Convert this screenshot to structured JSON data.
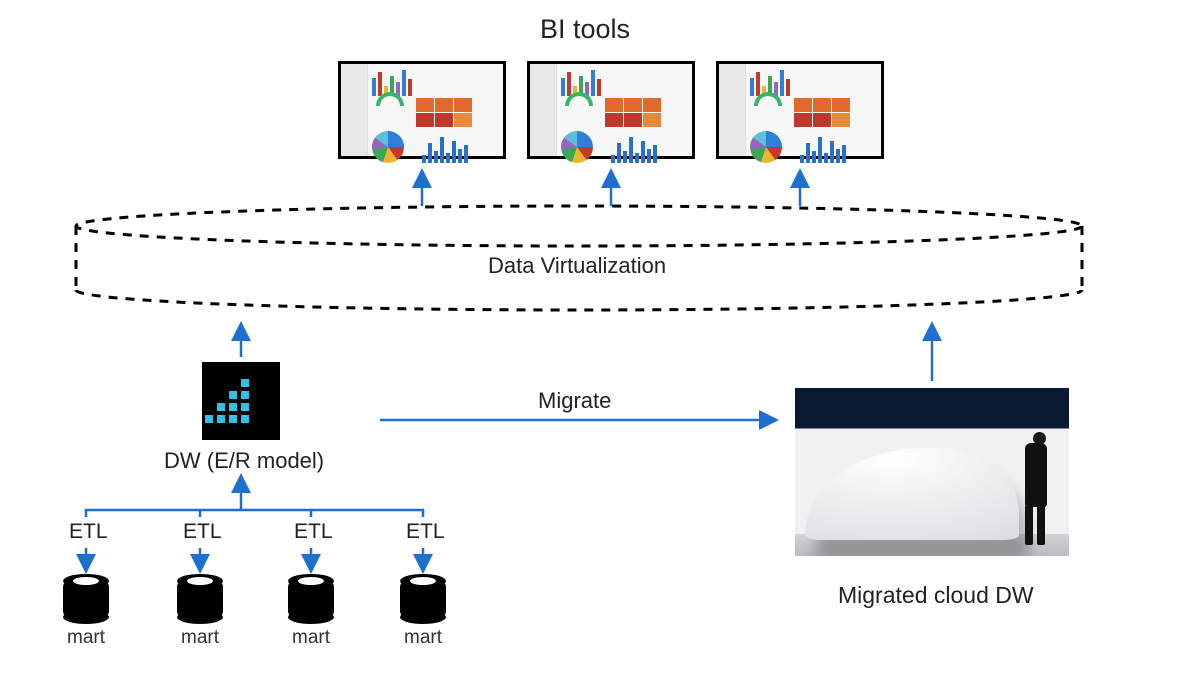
{
  "title": "BI tools",
  "virtualization_label": "Data Virtualization",
  "migrate_label": "Migrate",
  "dw_label": "DW (E/R model)",
  "etl_label": "ETL",
  "mart_label": "mart",
  "cloud_dw_label": "Migrated cloud DW"
}
